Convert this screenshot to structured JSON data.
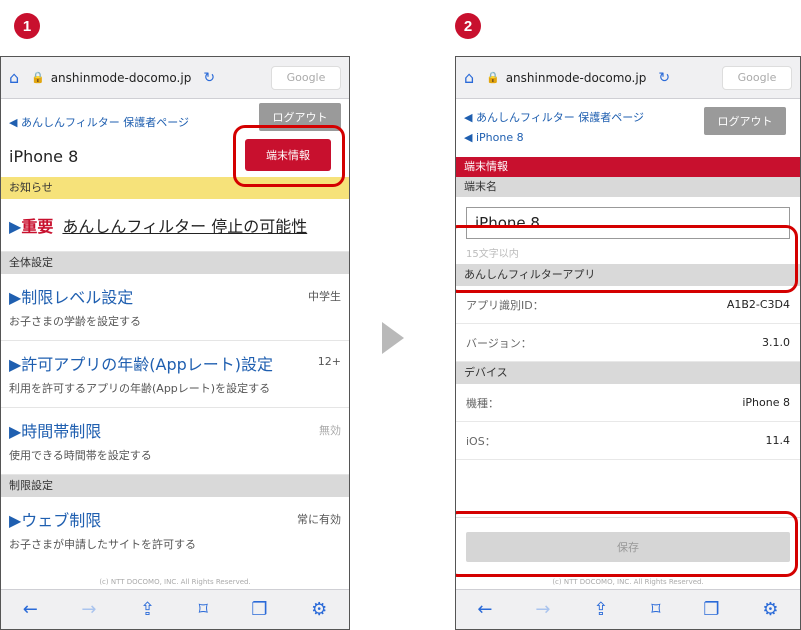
{
  "steps": [
    "1",
    "2"
  ],
  "browser": {
    "url": "anshinmode-docomo.jp",
    "search": "Google"
  },
  "left": {
    "back_link": "◀ あんしんフィルター 保護者ページ",
    "logout": "ログアウト",
    "device_name": "iPhone 8",
    "device_info_button": "端末情報",
    "notice_header": "お知らせ",
    "notice_important": "重要",
    "notice_text": "あんしんフィルター 停止の可能性",
    "section_all": "全体設定",
    "items_all": [
      {
        "title": "▶制限レベル設定",
        "value": "中学生",
        "desc": "お子さまの学齢を設定する"
      },
      {
        "title": "▶許可アプリの年齢(Appレート)設定",
        "value": "12+",
        "desc": "利用を許可するアプリの年齢(Appレート)を設定する"
      },
      {
        "title": "▶時間帯制限",
        "value": "無効",
        "desc": "使用できる時間帯を設定する"
      }
    ],
    "section_limit": "制限設定",
    "items_limit": [
      {
        "title": "▶ウェブ制限",
        "value": "常に有効",
        "desc": "お子さまが申請したサイトを許可する"
      }
    ],
    "copyright": "(c) NTT DOCOMO, INC. All Rights Reserved."
  },
  "right": {
    "back_link1": "◀ あんしんフィルター 保護者ページ",
    "back_link2": "◀ iPhone 8",
    "logout": "ログアウト",
    "page_header": "端末情報",
    "name_label": "端末名",
    "name_value": "iPhone 8",
    "name_hint": "15文字以内",
    "app_section": "あんしんフィルターアプリ",
    "app_rows": [
      {
        "label": "アプリ識別ID：",
        "value": "A1B2-C3D4"
      },
      {
        "label": "バージョン：",
        "value": "3.1.0"
      }
    ],
    "device_section": "デバイス",
    "device_rows": [
      {
        "label": "機種：",
        "value": "iPhone 8"
      },
      {
        "label": "iOS：",
        "value": "11.4"
      }
    ],
    "save_button": "保存",
    "copyright": "(c) NTT DOCOMO, INC. All Rights Reserved."
  },
  "toolbar_icons": [
    "back-arrow-icon",
    "forward-arrow-icon",
    "share-icon",
    "bookmark-icon",
    "tabs-icon",
    "settings-icon"
  ]
}
